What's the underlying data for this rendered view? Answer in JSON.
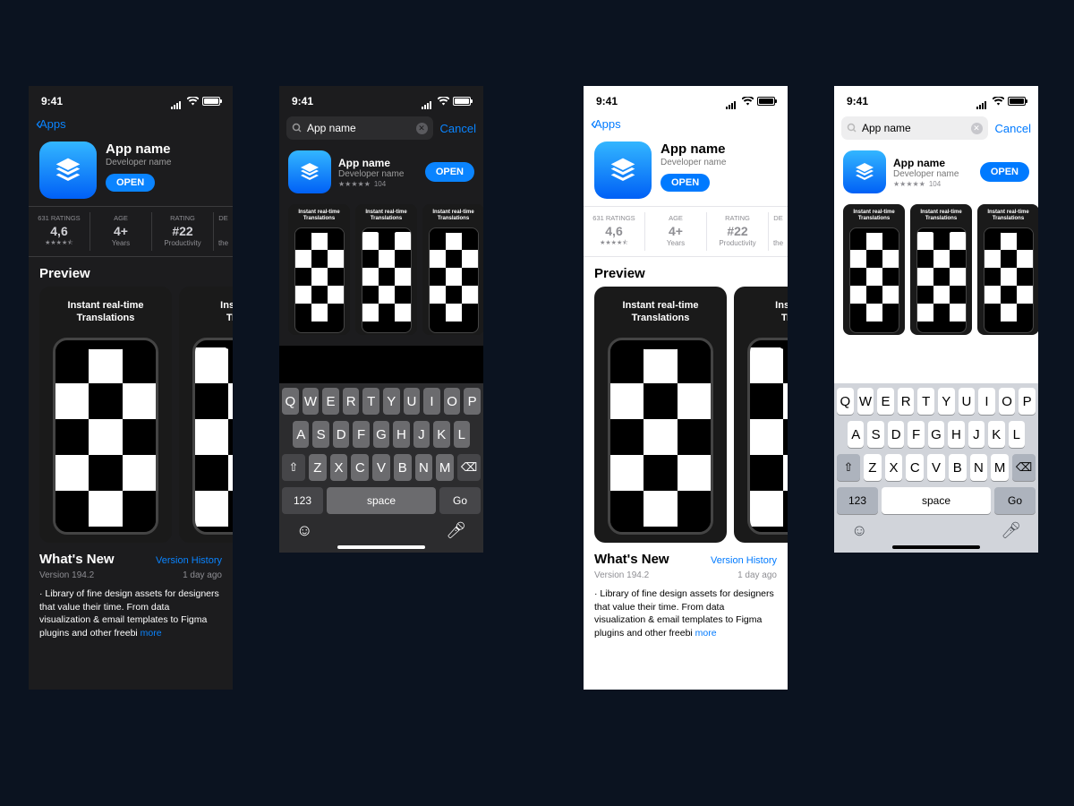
{
  "status": {
    "time": "9:41"
  },
  "nav": {
    "back_label": "Apps",
    "cancel": "Cancel"
  },
  "search": {
    "value": "App name"
  },
  "app": {
    "name": "App name",
    "developer": "Developer name",
    "open_btn": "OPEN",
    "rating_count": "104"
  },
  "metrics": {
    "ratings_label": "631 RATINGS",
    "ratings_value": "4,6",
    "age_label": "AGE",
    "age_value": "4+",
    "age_sub": "Years",
    "rating_label": "RATING",
    "rating_value": "#22",
    "rating_sub": "Productivity",
    "dev_label": "DE",
    "dev_sub": "the"
  },
  "preview": {
    "title": "Preview",
    "card_title": "Instant real-time\nTranslations",
    "card_title_cut": "Instant rea\nTranslat"
  },
  "search_preview": {
    "card_title": "Instant real-time\nTranslations"
  },
  "whats_new": {
    "title": "What's New",
    "history": "Version History",
    "version": "Version 194.2",
    "when": "1 day ago",
    "body": "· Library of fine design assets for designers that value their time. From data visualization & email templates to Figma plugins and other freebi ",
    "more": "more"
  },
  "keyboard": {
    "row1": [
      "Q",
      "W",
      "E",
      "R",
      "T",
      "Y",
      "U",
      "I",
      "O",
      "P"
    ],
    "row2": [
      "A",
      "S",
      "D",
      "F",
      "G",
      "H",
      "J",
      "K",
      "L"
    ],
    "row3": [
      "Z",
      "X",
      "C",
      "V",
      "B",
      "N",
      "M"
    ],
    "num": "123",
    "space": "space",
    "go": "Go"
  }
}
